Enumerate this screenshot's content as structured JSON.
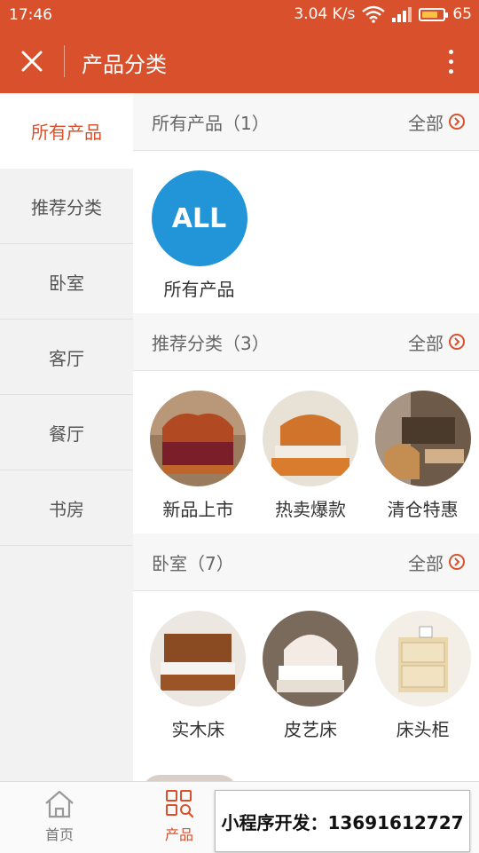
{
  "status": {
    "time": "17:46",
    "speed": "3.04 K/s",
    "battery": "65"
  },
  "header": {
    "title": "产品分类"
  },
  "sidebar": {
    "items": [
      {
        "label": "所有产品"
      },
      {
        "label": "推荐分类"
      },
      {
        "label": "卧室"
      },
      {
        "label": "客厅"
      },
      {
        "label": "餐厅"
      },
      {
        "label": "书房"
      }
    ]
  },
  "sections": [
    {
      "title": "所有产品（1）",
      "more": "全部",
      "items": [
        {
          "label": "所有产品",
          "badge": "ALL"
        }
      ]
    },
    {
      "title": "推荐分类（3）",
      "more": "全部",
      "items": [
        {
          "label": "新品上市"
        },
        {
          "label": "热卖爆款"
        },
        {
          "label": "清仓特惠"
        }
      ]
    },
    {
      "title": "卧室（7）",
      "more": "全部",
      "items": [
        {
          "label": "实木床"
        },
        {
          "label": "皮艺床"
        },
        {
          "label": "床头柜"
        }
      ]
    }
  ],
  "tabbar": {
    "tabs": [
      {
        "label": "首页"
      },
      {
        "label": "产品"
      }
    ]
  },
  "banner": {
    "text": "小程序开发：13691612727"
  },
  "colors": {
    "accent": "#d9512c",
    "all_badge": "#2195d7"
  }
}
